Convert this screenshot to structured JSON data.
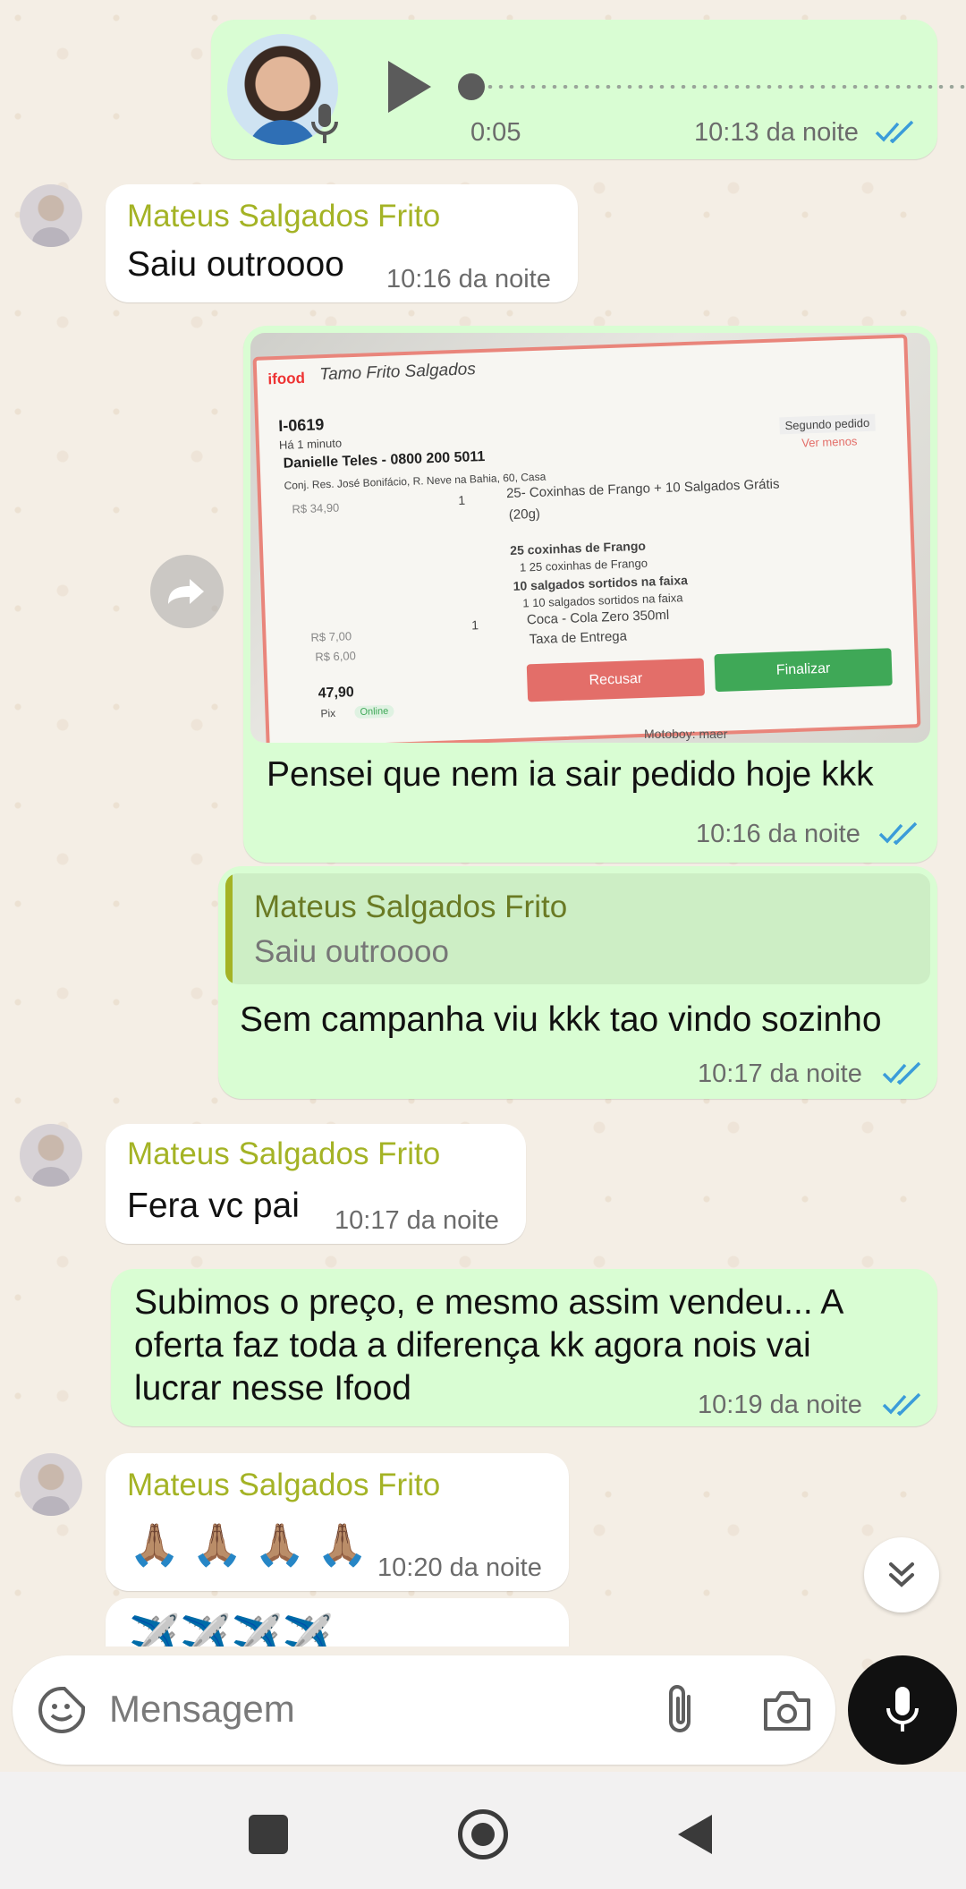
{
  "colors": {
    "outgoing_bubble": "#d9fdd3",
    "incoming_bubble": "#ffffff",
    "sender_name": "#a4b325",
    "read_ticks": "#53bdeb",
    "wallpaper": "#f4eee5"
  },
  "voice_message": {
    "duration": "0:05",
    "time": "10:13 da noite",
    "icons": [
      "play-icon",
      "mic-icon",
      "read-ticks-icon"
    ]
  },
  "messages": [
    {
      "sender": "Mateus Salgados Frito",
      "text": "Saiu outroooo",
      "time": "10:16 da noite"
    },
    {
      "caption": "Pensei que nem ia sair pedido hoje kkk",
      "time": "10:16 da noite",
      "photo": {
        "store": "Tamo Frito Salgados",
        "logo": "ifood",
        "order_id": "I-0619",
        "ago": "Há 1 minuto",
        "customer": "Danielle Teles - 0800 200 5011",
        "address": "Conj. Res. José Bonifácio, R. Neve na Bahia, 60, Casa",
        "badge": "Segundo pedido",
        "see_less": "Ver menos",
        "item_price": "R$ 34,90",
        "item_qty": "1",
        "item_name": "25- Coxinhas de Frango + 10 Salgados Grátis",
        "item_size": "(20g)",
        "sub1": "25 coxinhas de Frango",
        "sub1_detail": "1  25 coxinhas de Frango",
        "sub2": "10 salgados sortidos na faixa",
        "sub2_detail": "1  10 salgados sortidos na faixa",
        "drink_price": "R$ 7,00",
        "drink_qty": "1",
        "drink_name": "Coca - Cola Zero 350ml",
        "fee_price": "R$ 6,00",
        "fee_name": "Taxa de Entrega",
        "total": "47,90",
        "payment": "Pix",
        "payment_badge": "Online",
        "reject": "Recusar",
        "finish": "Finalizar",
        "footer": "Motoboy: maer"
      }
    },
    {
      "quote_sender": "Mateus Salgados Frito",
      "quote_text": "Saiu outroooo",
      "text": "Sem campanha viu kkk tao vindo sozinho",
      "time": "10:17 da noite"
    },
    {
      "sender": "Mateus Salgados Frito",
      "text": "Fera vc pai",
      "time": "10:17 da noite"
    },
    {
      "lines": [
        "Subimos o preço, e mesmo assim vendeu... A",
        "oferta faz toda a diferença kk agora nois vai",
        "lucrar nesse Ifood"
      ],
      "time": "10:19 da noite"
    },
    {
      "sender": "Mateus Salgados Frito",
      "text": "🙏🏽 🙏🏽 🙏🏽 🙏🏽",
      "time": "10:20 da noite"
    },
    {
      "text": "✈️✈️✈️✈️"
    }
  ],
  "composer": {
    "placeholder": "Mensagem",
    "icons": [
      "sticker-icon",
      "attach-icon",
      "camera-icon",
      "mic-icon"
    ]
  },
  "navbar": {
    "icons": [
      "recents-icon",
      "home-icon",
      "back-icon"
    ]
  }
}
